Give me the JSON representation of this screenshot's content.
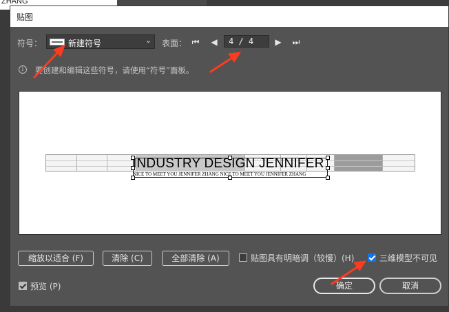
{
  "background": {
    "text": "ZHANG"
  },
  "dialog": {
    "title": "贴图",
    "symbol_label": "符号：",
    "symbol_value": "新建符号",
    "surface_label": "表面：",
    "page": "4 / 4",
    "info_text": "要创建和编辑这些符号，请使用“符号”面板。",
    "preview": {
      "headline": "INDUSTRY DESIGN JENNIFER",
      "subline": "NICE TO MEET YOU JENNIFER ZHANG  NICE TO MEET YOU JENNIFER ZHANG"
    },
    "buttons": {
      "fit": "缩放以适合 (F)",
      "clear": "清除 (C)",
      "clear_all": "全部清除 (A)",
      "ok": "确定",
      "cancel": "取消"
    },
    "checkboxes": {
      "shading": {
        "label": "贴图具有明暗调（较慢）(H)",
        "checked": false
      },
      "invisible": {
        "label": "三维模型不可见",
        "checked": true
      },
      "preview": {
        "label": "预览 (P)",
        "checked": true
      }
    }
  },
  "colors": {
    "accent": "#1473e6",
    "annotation": "#ff3b1f",
    "dialog_bg": "#535353"
  }
}
